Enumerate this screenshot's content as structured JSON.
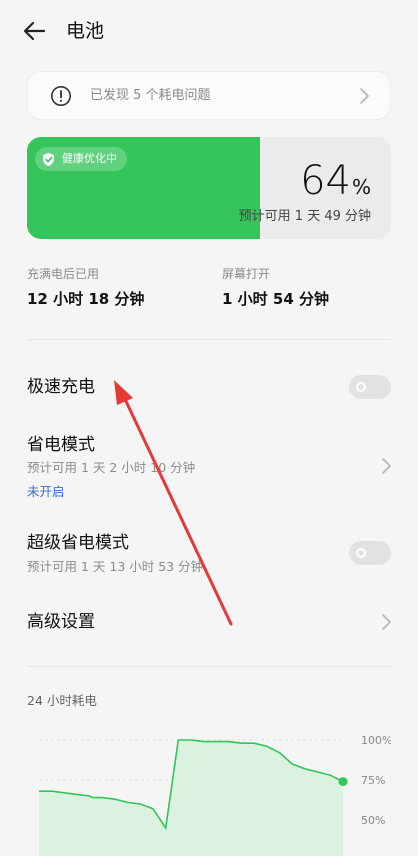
{
  "header": {
    "title": "电池",
    "back_icon": "arrow-left-icon"
  },
  "issues": {
    "text": "已发现 5 个耗电问题",
    "icon": "alert-circle-icon"
  },
  "battery": {
    "health_label": "健康优化中",
    "percent": "64",
    "percent_sign": "%",
    "level_fraction": 0.64,
    "estimate": "预计可用 1 天 49 分钟",
    "fill_color": "#34c45a"
  },
  "stats": {
    "since_full_label": "充满电后已用",
    "since_full_value": "12 小时 18 分钟",
    "screen_on_label": "屏幕打开",
    "screen_on_value": "1 小时 54 分钟"
  },
  "settings": {
    "fast_charge": {
      "title": "极速充电",
      "enabled": false
    },
    "power_saving": {
      "title": "省电模式",
      "subtitle": "预计可用 1 天 2 小时 10 分钟",
      "status": "未开启"
    },
    "super_power_saving": {
      "title": "超级省电模式",
      "subtitle": "预计可用 1 天 13 小时 53 分钟",
      "enabled": false
    },
    "advanced": {
      "title": "高级设置"
    }
  },
  "usage": {
    "section_label": "24 小时耗电",
    "y_labels": [
      "100%",
      "75%",
      "50%"
    ]
  },
  "chart_data": {
    "type": "area",
    "title": "",
    "ylabel": "",
    "xlabel": "",
    "ylim": [
      40,
      100
    ],
    "yticks": [
      100,
      75,
      50
    ],
    "grid": true,
    "series": [
      {
        "x": [
          0,
          1,
          2,
          3,
          4,
          4.2,
          5,
          6,
          7,
          8,
          9,
          10,
          11,
          12,
          13,
          14,
          15,
          16,
          17,
          18,
          19,
          20,
          21,
          22,
          23,
          24
        ],
        "values": [
          68,
          68,
          67,
          66,
          65,
          64,
          64,
          63,
          61,
          60,
          57,
          45,
          100,
          100,
          99,
          99,
          99,
          98,
          98,
          96,
          92,
          85,
          82,
          80,
          78,
          74
        ]
      }
    ]
  }
}
